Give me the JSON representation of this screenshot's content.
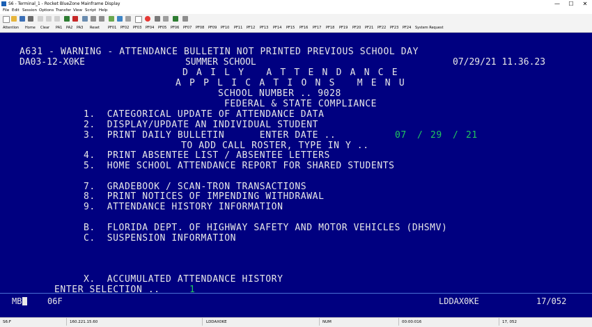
{
  "window": {
    "title": "S6 - Terminal_1 - Rocket BlueZone Mainframe Display",
    "controls": [
      "—",
      "☐",
      "✕"
    ]
  },
  "menu": [
    "File",
    "Edit",
    "Session",
    "Options",
    "Transfer",
    "View",
    "Script",
    "Help"
  ],
  "pfkeys": [
    "Attention",
    "Home",
    "Clear",
    "PA1",
    "PA2",
    "PA3",
    "Reset",
    "PF01",
    "PF02",
    "PF03",
    "PF04",
    "PF05",
    "PF06",
    "PF07",
    "PF08",
    "PF09",
    "PF10",
    "PF11",
    "PF12",
    "PF13",
    "PF14",
    "PF15",
    "PF16",
    "PF17",
    "PF18",
    "PF19",
    "PF20",
    "PF21",
    "PF22",
    "PF23",
    "PF24",
    "System Request"
  ],
  "screen": {
    "warning": "A631 - WARNING - ATTENDANCE BULLETIN NOT PRINTED PREVIOUS SCHOOL DAY",
    "screen_id": "DA03-12-X0KE",
    "school_session": "SUMMER SCHOOL",
    "datetime": "07/29/21 11.36.23",
    "title1": "D A I L Y   A T T E N D A N C E",
    "title2": "A P P L I C A T I O N S   M E N U",
    "school_number": "SCHOOL NUMBER .. 9028",
    "compliance": "FEDERAL & STATE COMPLIANCE",
    "opt1": "1.  CATEGORICAL UPDATE OF ATTENDANCE DATA",
    "opt2": "2.  DISPLAY/UPDATE AN INDIVIDUAL STUDENT",
    "opt3": "3.  PRINT DAILY BULLETIN      ENTER DATE ..",
    "date_mm": "07",
    "date_sep1": "/",
    "date_dd": "29",
    "date_sep2": "/",
    "date_yy": "21",
    "call_roster": "TO ADD CALL ROSTER, TYPE IN Y ..",
    "opt4": "4.  PRINT ABSENTEE LIST / ABSENTEE LETTERS",
    "opt5": "5.  HOME SCHOOL ATTENDANCE REPORT FOR SHARED STUDENTS",
    "opt7": "7.  GRADEBOOK / SCAN-TRON TRANSACTIONS",
    "opt8": "8.  PRINT NOTICES OF IMPENDING WITHDRAWAL",
    "opt9": "9.  ATTENDANCE HISTORY INFORMATION",
    "optB": "B.  FLORIDA DEPT. OF HIGHWAY SAFETY AND MOTOR VEHICLES (DHSMV)",
    "optC": "C.  SUSPENSION INFORMATION",
    "optX": "X.  ACCUMULATED ATTENDANCE HISTORY",
    "enter_selection": "ENTER SELECTION ..",
    "selection_value": "1"
  },
  "oia": {
    "left": "MB",
    "code": "06F",
    "lu": "LDDAX0KE",
    "cursor_pos": "17/052"
  },
  "statusbar": {
    "session": "S6:F",
    "host": "160.221.15.60",
    "lu": "LDDAX0KE",
    "num": "NUM",
    "timer": "00:00:016",
    "pos": "17, 052"
  },
  "colors": {
    "screen_bg": "#000080",
    "text": "#e8e8e8",
    "input": "#22c55e"
  }
}
